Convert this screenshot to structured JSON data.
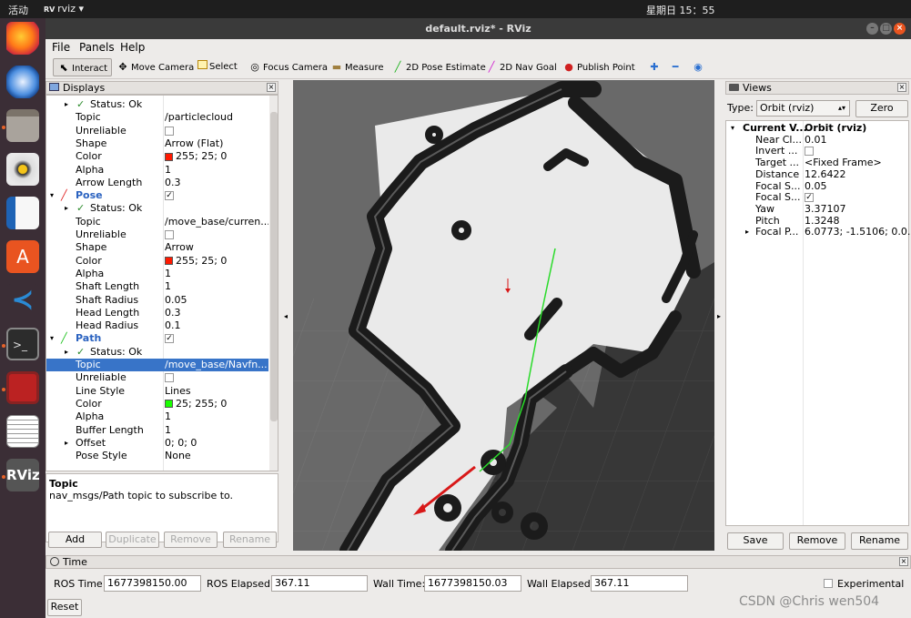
{
  "topbar": {
    "activities": "活动",
    "app": "rviz",
    "clock": "星期日 15：55"
  },
  "window": {
    "title": "default.rviz* - RViz"
  },
  "menu": [
    "File",
    "Panels",
    "Help"
  ],
  "toolbar": {
    "interact": "Interact",
    "move_camera": "Move Camera",
    "select": "Select",
    "focus_camera": "Focus Camera",
    "measure": "Measure",
    "pose_estimate": "2D Pose Estimate",
    "nav_goal": "2D Nav Goal",
    "publish_point": "Publish Point"
  },
  "displays": {
    "title": "Displays",
    "rows": [
      {
        "k": "Status: Ok",
        "v": "",
        "indent": 1,
        "arrow": "▸",
        "check": true
      },
      {
        "k": "Topic",
        "v": "/particlecloud"
      },
      {
        "k": "Unreliable",
        "v": "",
        "box": true
      },
      {
        "k": "Shape",
        "v": "Arrow (Flat)"
      },
      {
        "k": "Color",
        "v": "255; 25; 0",
        "swatch": "#ff1900"
      },
      {
        "k": "Alpha",
        "v": "1"
      },
      {
        "k": "Arrow Length",
        "v": "0.3"
      },
      {
        "k": "Pose",
        "v": "",
        "head": true,
        "box": true,
        "checked": true,
        "icon": "#e02020"
      },
      {
        "k": "Status: Ok",
        "v": "",
        "indent": 1,
        "arrow": "▸",
        "check": true
      },
      {
        "k": "Topic",
        "v": "/move_base/curren..."
      },
      {
        "k": "Unreliable",
        "v": "",
        "box": true
      },
      {
        "k": "Shape",
        "v": "Arrow"
      },
      {
        "k": "Color",
        "v": "255; 25; 0",
        "swatch": "#ff1900"
      },
      {
        "k": "Alpha",
        "v": "1"
      },
      {
        "k": "Shaft Length",
        "v": "1"
      },
      {
        "k": "Shaft Radius",
        "v": "0.05"
      },
      {
        "k": "Head Length",
        "v": "0.3"
      },
      {
        "k": "Head Radius",
        "v": "0.1"
      },
      {
        "k": "Path",
        "v": "",
        "head": true,
        "box": true,
        "checked": true,
        "icon": "#19c019"
      },
      {
        "k": "Status: Ok",
        "v": "",
        "indent": 1,
        "arrow": "▸",
        "check": true
      },
      {
        "k": "Topic",
        "v": "/move_base/Navfn...",
        "sel": true
      },
      {
        "k": "Unreliable",
        "v": "",
        "box": true
      },
      {
        "k": "Line Style",
        "v": "Lines"
      },
      {
        "k": "Color",
        "v": "25; 255; 0",
        "swatch": "#19ff00"
      },
      {
        "k": "Alpha",
        "v": "1"
      },
      {
        "k": "Buffer Length",
        "v": "1"
      },
      {
        "k": "Offset",
        "v": "0; 0; 0",
        "arrow": "▸"
      },
      {
        "k": "Pose Style",
        "v": "None"
      }
    ],
    "desc_title": "Topic",
    "desc_text": "nav_msgs/Path topic to subscribe to.",
    "buttons": [
      "Add",
      "Duplicate",
      "Remove",
      "Rename"
    ]
  },
  "views": {
    "title": "Views",
    "type_label": "Type:",
    "type_value": "Orbit (rviz)",
    "zero": "Zero",
    "rows": [
      {
        "k": "Current V...",
        "v": "Orbit (rviz)",
        "bold": true,
        "arrow": "▾"
      },
      {
        "k": "Near Cl...",
        "v": "0.01"
      },
      {
        "k": "Invert ...",
        "v": "",
        "box": true
      },
      {
        "k": "Target ...",
        "v": "<Fixed Frame>"
      },
      {
        "k": "Distance",
        "v": "12.6422"
      },
      {
        "k": "Focal S...",
        "v": "0.05"
      },
      {
        "k": "Focal S...",
        "v": "✓",
        "box": true
      },
      {
        "k": "Yaw",
        "v": "3.37107"
      },
      {
        "k": "Pitch",
        "v": "1.3248"
      },
      {
        "k": "Focal P...",
        "v": "6.0773; -1.5106; 0.0...",
        "arrow": "▸"
      }
    ],
    "buttons": [
      "Save",
      "Remove",
      "Rename"
    ]
  },
  "time": {
    "title": "Time",
    "ros_time_label": "ROS Time:",
    "ros_time": "1677398150.00",
    "ros_elapsed_label": "ROS Elapsed:",
    "ros_elapsed": "367.11",
    "wall_time_label": "Wall Time:",
    "wall_time": "1677398150.03",
    "wall_elapsed_label": "Wall Elapsed:",
    "wall_elapsed": "367.11",
    "experimental": "Experimental",
    "reset": "Reset"
  },
  "watermark": "CSDN @Chris wen504"
}
